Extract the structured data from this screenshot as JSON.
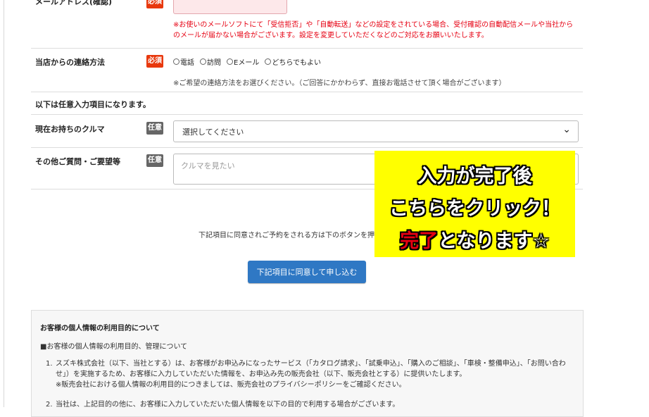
{
  "form": {
    "email": {
      "label": "メールアドレス(確認)",
      "badge": "必須",
      "note": "※お使いのメールソフトにて「受信拒否」や「自動転送」などの設定をされている場合、受付確認の自動配信メールや当社からのメールが届かない場合がございます。設定を変更していただくなどのご対応をお願いいたします。"
    },
    "contact_method": {
      "label": "当店からの連絡方法",
      "badge": "必須",
      "options": [
        "電話",
        "訪問",
        "Eメール",
        "どちらでもよい"
      ],
      "note": "※ご希望の連絡方法をお選びください。（ご回答にかかわらず、直接お電話させて頂く場合がございます）"
    },
    "optional_heading": "以下は任意入力項目になります。",
    "current_car": {
      "label": "現在お持ちのクルマ",
      "badge": "任意",
      "selected": "選択してください"
    },
    "questions": {
      "label": "その他ご質問・ご要望等",
      "badge": "任意",
      "placeholder": "クルマを見たい"
    },
    "agree_text": "下記項目に同意されご予約をされる方は下のボタンを押し",
    "submit_label": "下記項目に同意して申し込む"
  },
  "callout": {
    "line1": "入力が完了後",
    "line2": "こちらをクリック！",
    "line3_red": "完了",
    "line3_rest": "となります☆"
  },
  "privacy": {
    "title": "お客様の個人情報の利用目的について",
    "subtitle": "■お客様の個人情報の利用目的、管理について",
    "items": [
      {
        "num": "1.",
        "text": "スズキ株式会社（以下、当社とする）は、お客様がお申込みになったサービス（「カタログ請求」、「試乗申込」、「購入のご相談」、「車検・整備申込」、「お問い合わせ」）を実施するため、お客様に入力していただいた情報を、お申込み先の販売会社（以下、販売会社とする）に提供いたします。",
        "sub": "※販売会社における個人情報の利用目的につきましては、販売会社のプライバシーポリシーをご確認ください。"
      },
      {
        "num": "2.",
        "text": "当社は、上記目的の他に、お客様に入力していただいた個人情報を以下の目的で利用する場合がございます。"
      }
    ]
  }
}
